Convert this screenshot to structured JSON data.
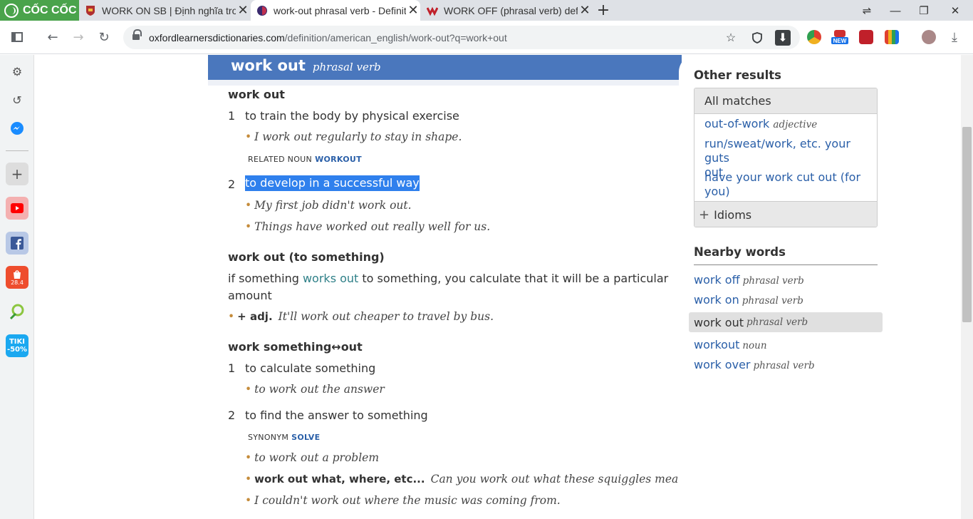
{
  "browser": {
    "brand": "CỐC CỐC",
    "tabs": [
      {
        "title": "WORK ON SB | Định nghĩa trong",
        "favicon_color": "#b03030"
      },
      {
        "title": "work-out phrasal verb - Definition",
        "favicon_color": "#3a2a6e"
      },
      {
        "title": "WORK OFF (phrasal verb) definition",
        "favicon_color": "#c0202a"
      }
    ],
    "url_host": "oxfordlearnersdictionaries.com",
    "url_path": "/definition/american_english/work-out?q=work+out",
    "ext_badge": "NEW"
  },
  "sidebar": {
    "shopee_badge": "28.4",
    "tiki_badge_top": "TIKI",
    "tiki_badge_bottom": "-50%"
  },
  "entry": {
    "headword": "work out",
    "pos": "phrasal verb",
    "sense_groups": [
      {
        "phrase": "work out",
        "senses": [
          {
            "num": "1",
            "def": "to train the body by physical exercise",
            "examples": [
              "I work out regularly to stay in shape."
            ],
            "related_label": "RELATED NOUN",
            "related_link": "WORKOUT"
          },
          {
            "num": "2",
            "def": "to develop in a successful way",
            "examples": [
              "My first job didn't work out.",
              "Things have worked out really well for us."
            ]
          }
        ]
      },
      {
        "phrase": "work out (to something)",
        "def_line1_a": "if something",
        "def_line1_link": "works out",
        "def_line1_b": "to something, you calculate that it will be a particular",
        "def_line2": "amount",
        "example_cf": "+ adj.",
        "example": "It'll work out cheaper to travel by bus."
      },
      {
        "phrase": "work something↔out",
        "senses": [
          {
            "num": "1",
            "def": "to calculate something",
            "examples": [
              "to work out the answer"
            ]
          },
          {
            "num": "2",
            "def": "to find the answer to something",
            "synonym_label": "SYNONYM",
            "synonym_link": "SOLVE",
            "examples": [
              "to work out a problem"
            ],
            "example_cf": "work out what, where, etc...",
            "example_cf_text": "Can you work out what these squiggles mean?",
            "example_last": "I couldn't work out where the music was coming from."
          }
        ]
      }
    ]
  },
  "other_results": {
    "heading": "Other results",
    "all_matches": "All matches",
    "items": [
      {
        "word": "out-of-work",
        "pos": "adjective"
      },
      {
        "word": "run/sweat/work, etc. your guts",
        "word2": "out"
      },
      {
        "word": "have your work cut out (for",
        "word2": "you)"
      }
    ],
    "idioms": "Idioms"
  },
  "nearby": {
    "heading": "Nearby words",
    "items": [
      {
        "word": "work off",
        "pos": "phrasal verb"
      },
      {
        "word": "work on",
        "pos": "phrasal verb"
      },
      {
        "word": "work out",
        "pos": "phrasal verb"
      },
      {
        "word": "workout",
        "pos": "noun"
      },
      {
        "word": "work over",
        "pos": "phrasal verb"
      }
    ]
  }
}
